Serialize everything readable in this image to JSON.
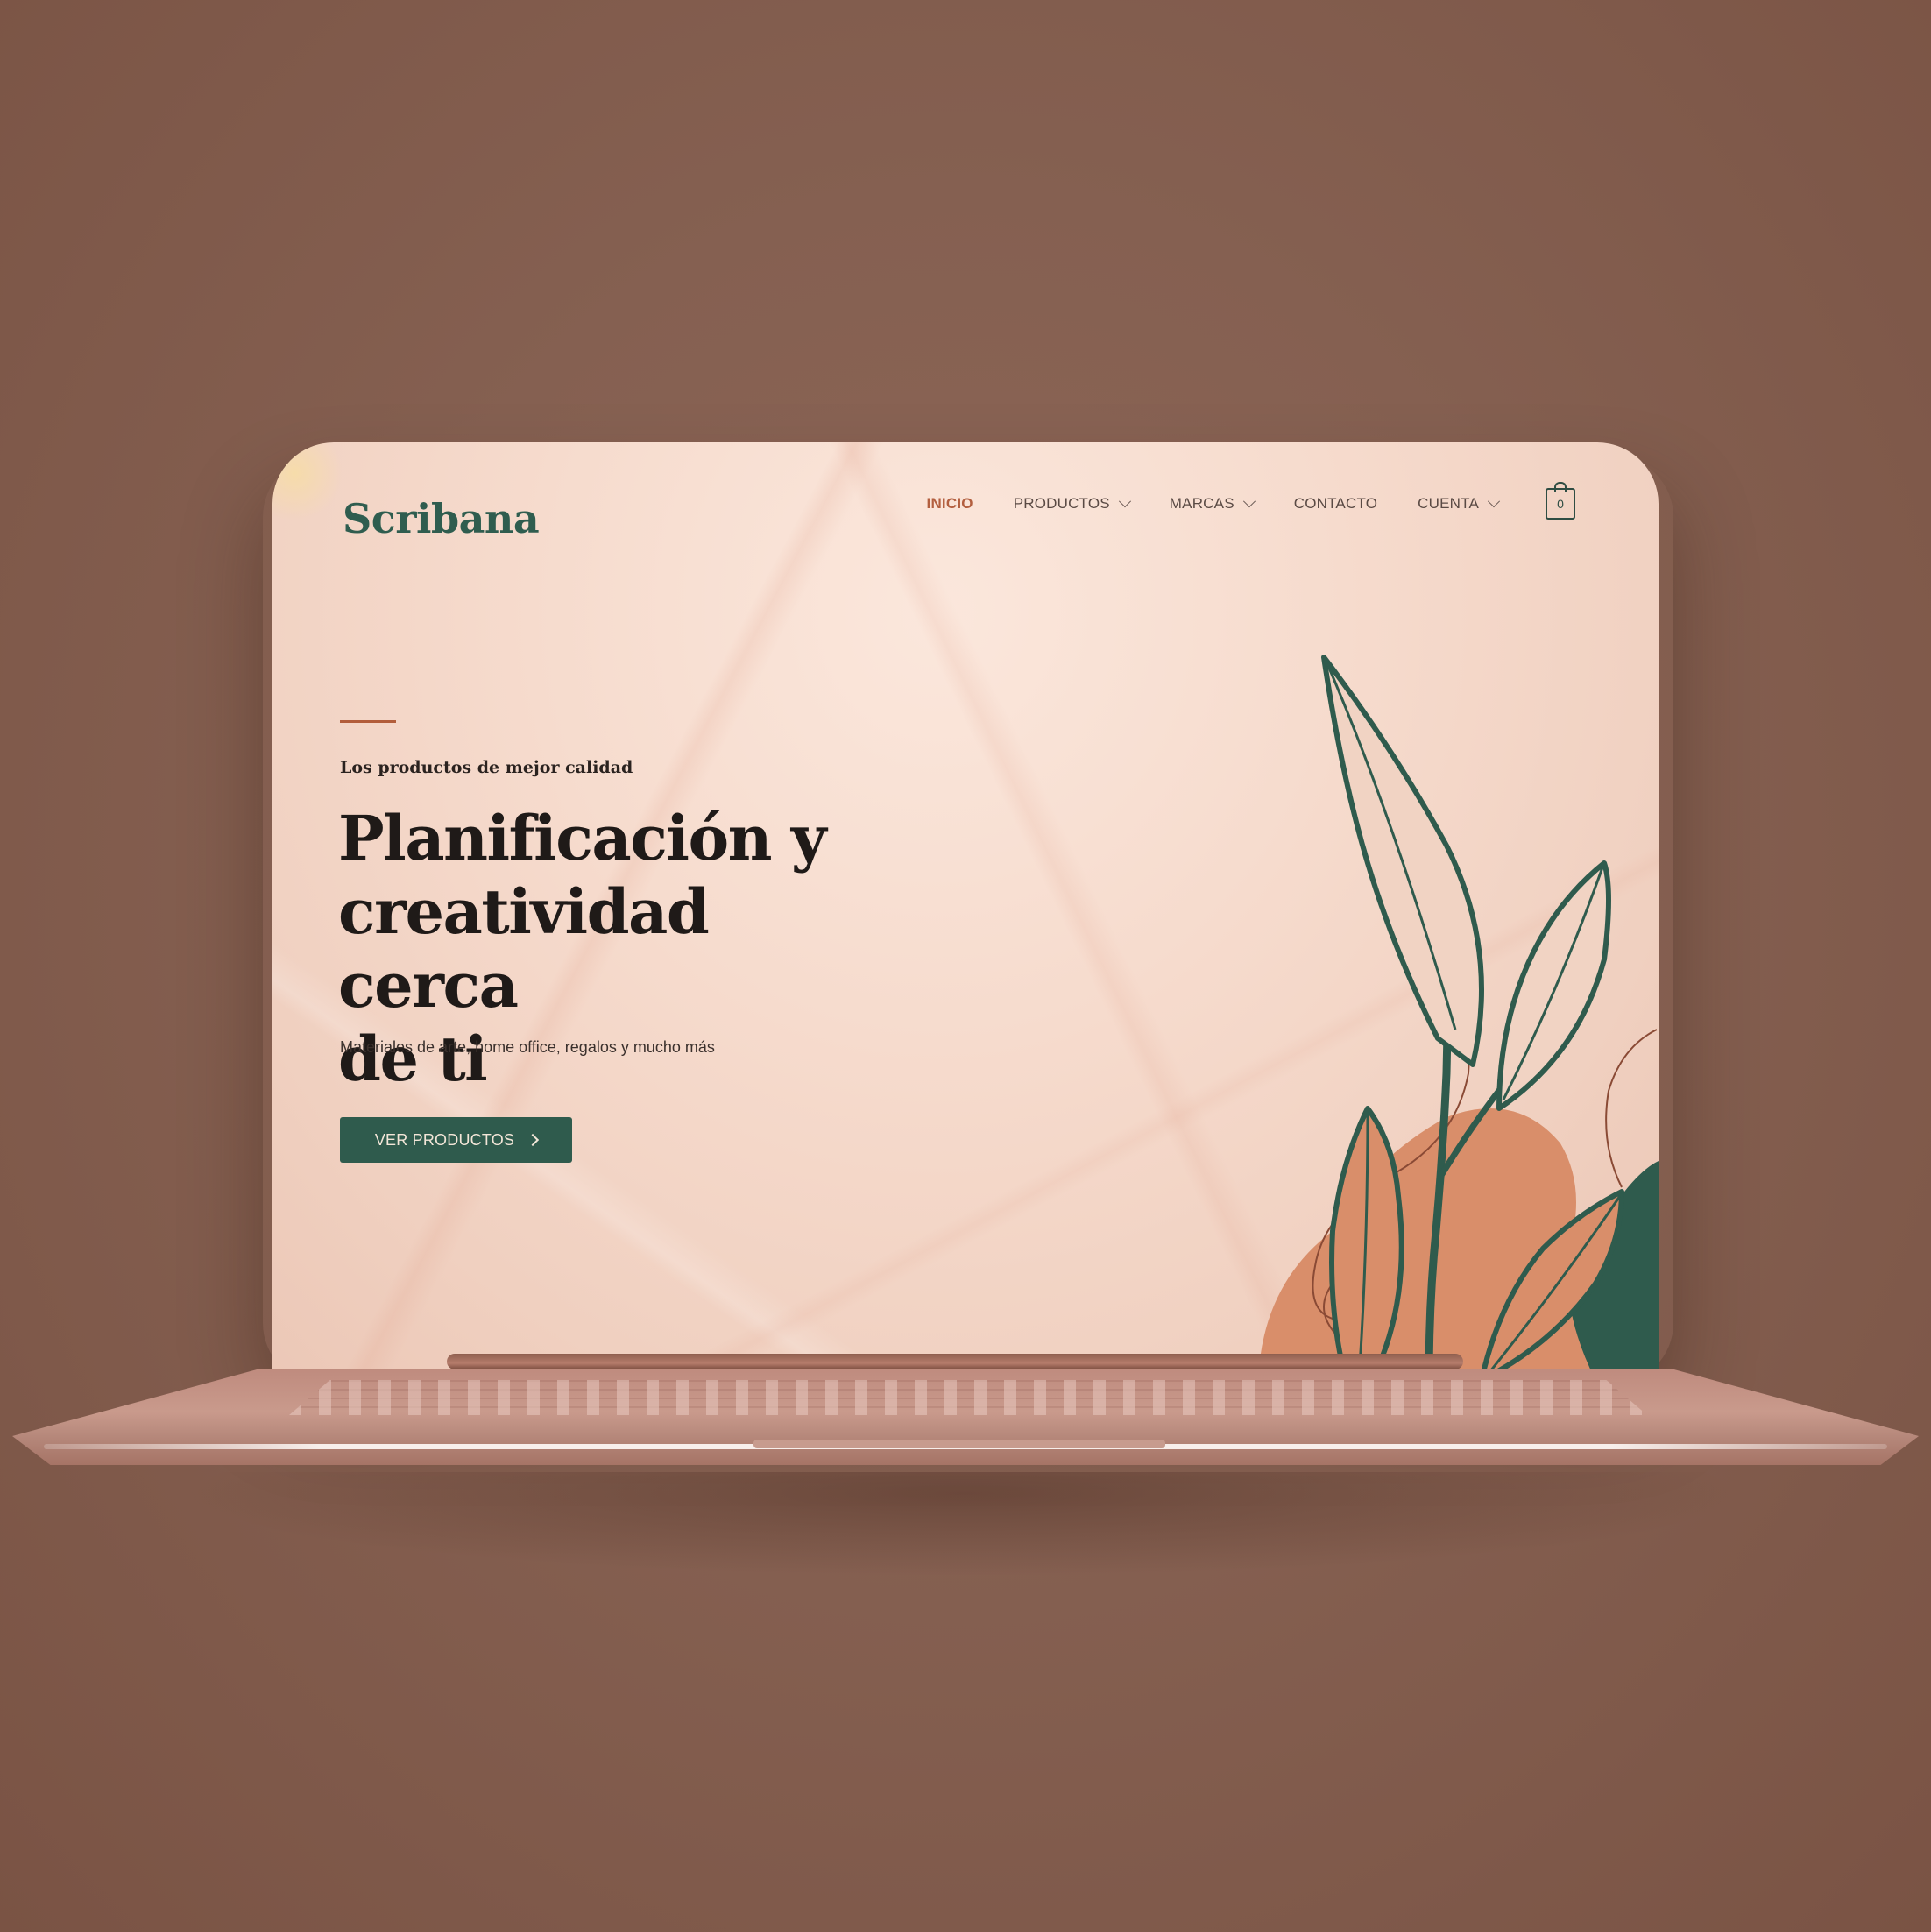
{
  "site": {
    "logo": "Scribana"
  },
  "nav": {
    "items": [
      {
        "label": "INICIO",
        "active": true,
        "dropdown": false
      },
      {
        "label": "PRODUCTOS",
        "active": false,
        "dropdown": true
      },
      {
        "label": "MARCAS",
        "active": false,
        "dropdown": true
      },
      {
        "label": "CONTACTO",
        "active": false,
        "dropdown": false
      },
      {
        "label": "CUENTA",
        "active": false,
        "dropdown": true
      }
    ],
    "cart_count": "0",
    "cart_icon": "shopping-bag-icon"
  },
  "hero": {
    "eyebrow": "Los productos de mejor calidad",
    "headline_line1": "Planificación y",
    "headline_line2": "creatividad cerca",
    "headline_line3": "de ti",
    "subtext": "Materiales de arte, home office, regalos y mucho más",
    "cta_label": "VER PRODUCTOS",
    "cta_icon": "chevron-right-icon"
  },
  "colors": {
    "background": "#8a6354",
    "brand_green": "#2f5b4d",
    "accent_terracotta": "#b35f3f",
    "blob_orange": "#d98e6a",
    "screen_pink": "#f6dbcd"
  }
}
